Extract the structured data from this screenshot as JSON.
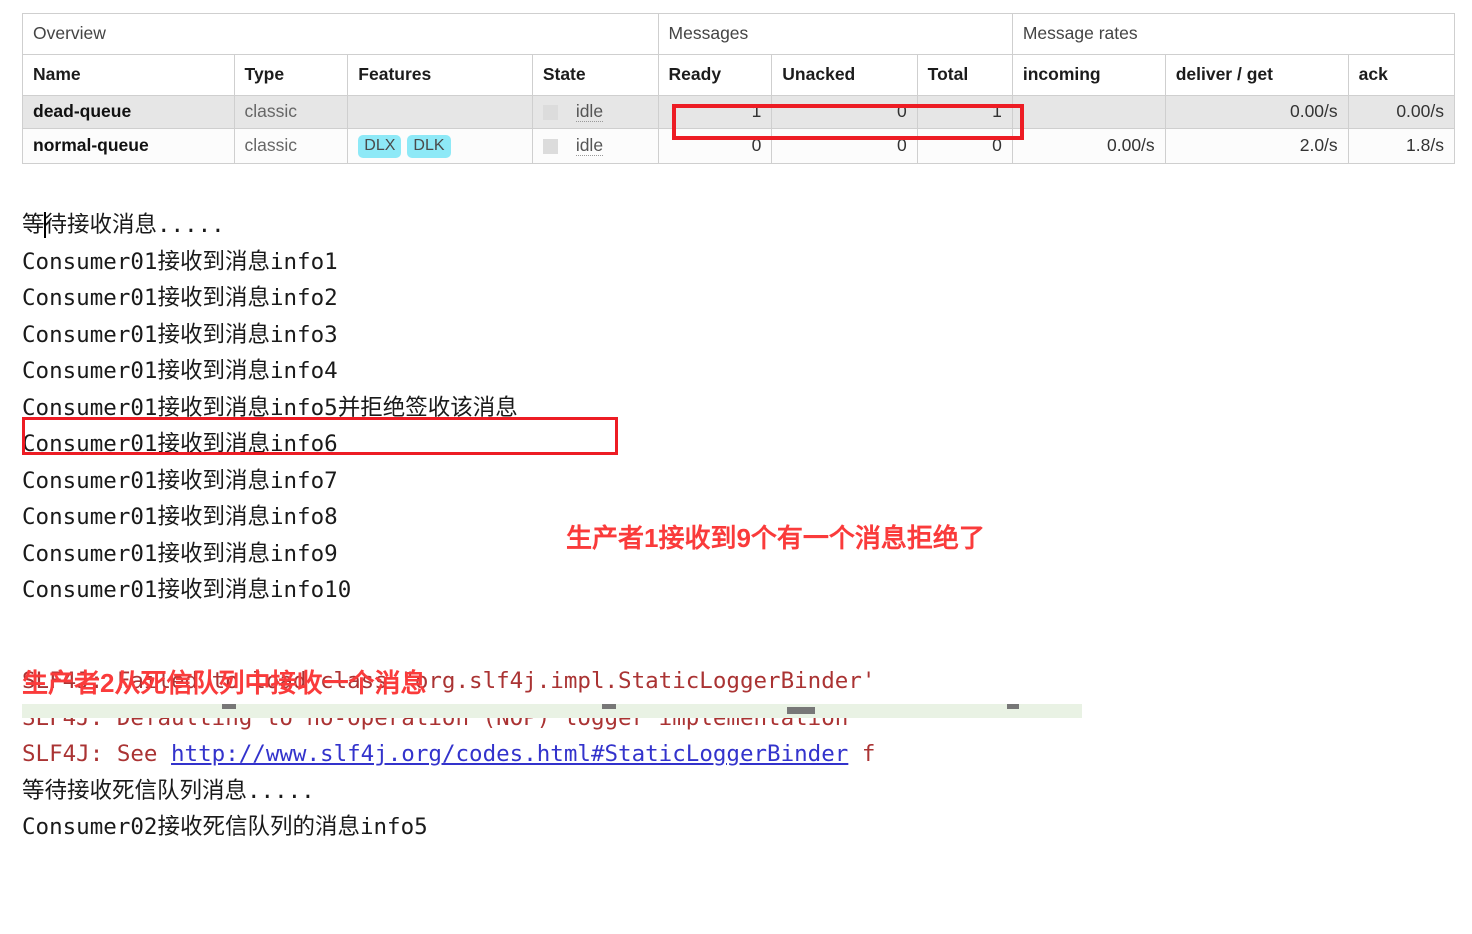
{
  "queue_table": {
    "group_headers": [
      {
        "label": "Overview",
        "colspan": 4
      },
      {
        "label": "Messages",
        "colspan": 3
      },
      {
        "label": "Message rates",
        "colspan": 3
      }
    ],
    "columns": [
      "Name",
      "Type",
      "Features",
      "State",
      "Ready",
      "Unacked",
      "Total",
      "incoming",
      "deliver / get",
      "ack"
    ],
    "rows": [
      {
        "name": "dead-queue",
        "type": "classic",
        "features": [],
        "state": "idle",
        "ready": "1",
        "unacked": "0",
        "total": "1",
        "incoming": "",
        "deliver_get": "0.00/s",
        "ack": "0.00/s"
      },
      {
        "name": "normal-queue",
        "type": "classic",
        "features": [
          "DLX",
          "DLK"
        ],
        "state": "idle",
        "ready": "0",
        "unacked": "0",
        "total": "0",
        "incoming": "0.00/s",
        "deliver_get": "2.0/s",
        "ack": "1.8/s"
      }
    ],
    "highlight_color": "#ed1c24"
  },
  "console": {
    "lines": [
      {
        "text": "等待接收消息.....",
        "style": "normal",
        "caret": true
      },
      {
        "text": "Consumer01接收到消息info1",
        "style": "normal"
      },
      {
        "text": "Consumer01接收到消息info2",
        "style": "normal"
      },
      {
        "text": "Consumer01接收到消息info3",
        "style": "normal"
      },
      {
        "text": "Consumer01接收到消息info4",
        "style": "normal"
      },
      {
        "text": "Consumer01接收到消息info5并拒绝签收该消息",
        "style": "normal",
        "boxed": true
      },
      {
        "text": "Consumer01接收到消息info6",
        "style": "normal"
      },
      {
        "text": "Consumer01接收到消息info7",
        "style": "normal"
      },
      {
        "text": "Consumer01接收到消息info8",
        "style": "normal"
      },
      {
        "text": "Consumer01接收到消息info9",
        "style": "normal"
      },
      {
        "text": "Consumer01接收到消息info10",
        "style": "normal"
      }
    ],
    "slf4j_lines": [
      {
        "prefix": "SLF4J: Failed to load class \"org.slf4j.impl.StaticLoggerBinder'",
        "url": "",
        "suffix": ""
      },
      {
        "prefix": "SLF4J: Defaulting to no-operation (NOP) logger implementation",
        "url": "",
        "suffix": ""
      },
      {
        "prefix": "SLF4J: See ",
        "url": "http://www.slf4j.org/codes.html#StaticLoggerBinder",
        "suffix": " f"
      }
    ],
    "tail_lines": [
      {
        "text": "等待接收死信队列消息.....",
        "style": "normal"
      },
      {
        "text": "Consumer02接收死信队列的消息info5",
        "style": "normal"
      }
    ]
  },
  "annotations": [
    {
      "id": "annotation-1",
      "text": "生产者1接收到9个有一个消息拒绝了",
      "color": "#fa3b3b"
    },
    {
      "id": "annotation-2",
      "text": "生产者2从死信队列中接收一个消息",
      "color": "#fa3b3b"
    }
  ]
}
